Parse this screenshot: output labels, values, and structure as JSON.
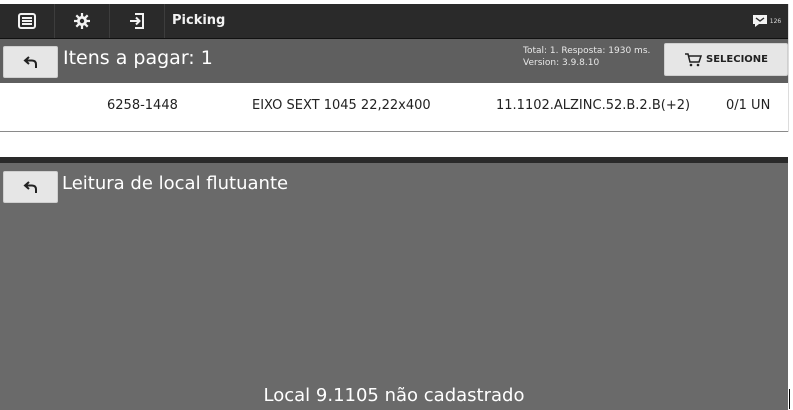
{
  "toolbar": {
    "title": "Picking",
    "badge_count": "126",
    "icons": [
      "list-menu-icon",
      "gear-icon",
      "login-icon",
      "chat-icon"
    ]
  },
  "header": {
    "title": "Itens a pagar: 1",
    "stats_line1": "Total: 1. Resposta: 1930 ms.",
    "stats_line2": "Version: 3.9.8.10",
    "select_label": "SELECIONE"
  },
  "item": {
    "code": "6258-1448",
    "description": "EIXO SEXT 1045 22,22x400",
    "location": "11.1102.ALZINC.52.B.2.B(+2)",
    "quantity": "0/1 UN"
  },
  "bottom": {
    "title": "Leitura de local flutuante",
    "message": "Local 9.1105 não cadastrado"
  },
  "colors": {
    "toolbar_bg": "#2a2a2a",
    "header_bg": "#5f5f5f",
    "dialog_bg": "#6a6a6a",
    "button_bg": "#e6e6e6"
  }
}
